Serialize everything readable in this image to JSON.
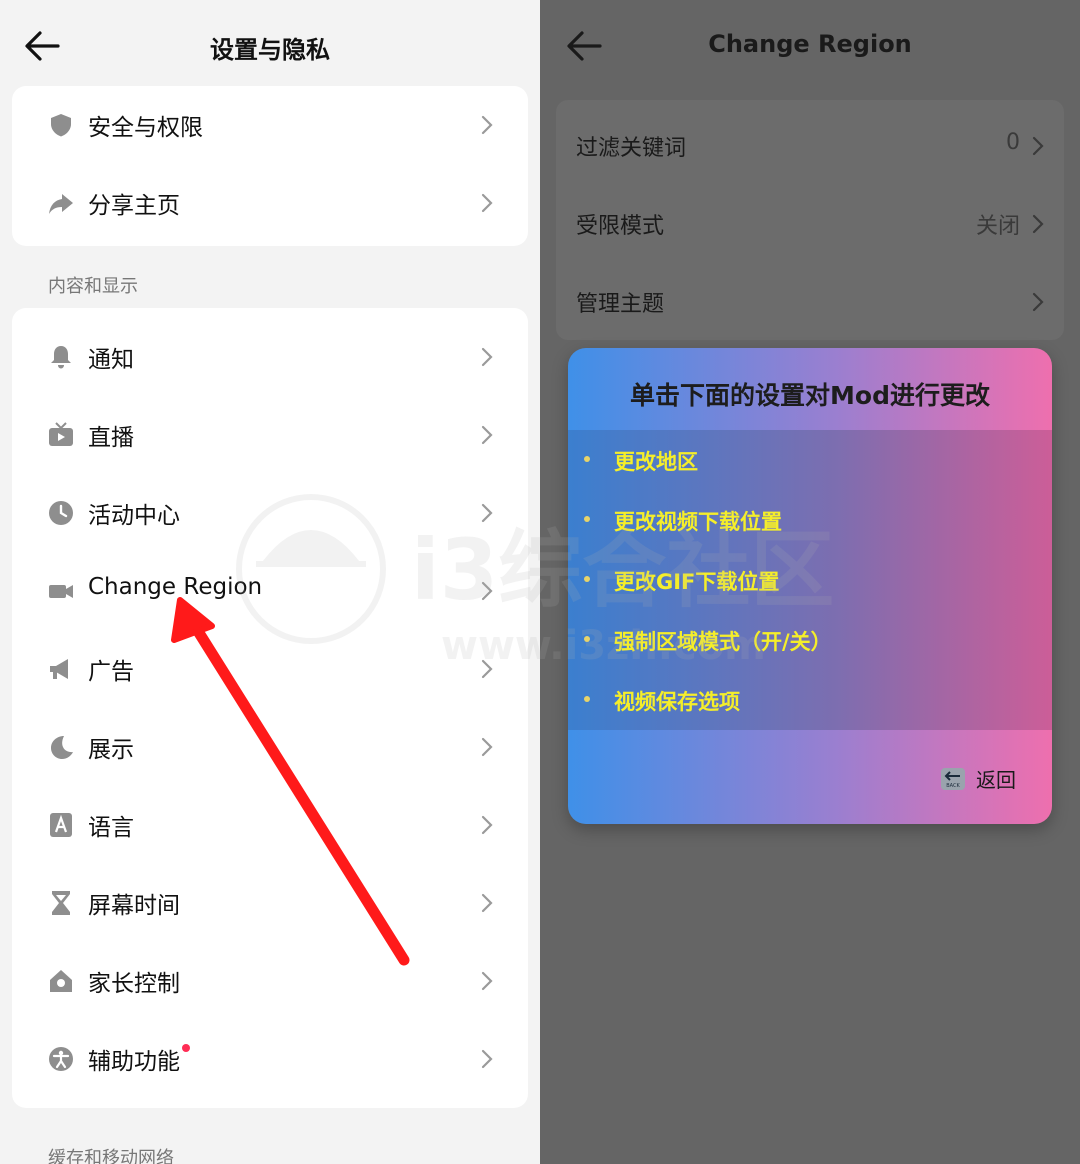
{
  "left": {
    "title": "设置与隐私",
    "group1": [
      {
        "label": "安全与权限",
        "icon": "shield-icon"
      },
      {
        "label": "分享主页",
        "icon": "share-icon"
      }
    ],
    "section_content": "内容和显示",
    "group2": [
      {
        "label": "通知",
        "icon": "bell-icon"
      },
      {
        "label": "直播",
        "icon": "tv-icon"
      },
      {
        "label": "活动中心",
        "icon": "clock-icon"
      },
      {
        "label": "Change Region",
        "icon": "video-camera-icon"
      },
      {
        "label": "广告",
        "icon": "megaphone-icon"
      },
      {
        "label": "展示",
        "icon": "moon-icon"
      },
      {
        "label": "语言",
        "icon": "language-icon"
      },
      {
        "label": "屏幕时间",
        "icon": "hourglass-icon"
      },
      {
        "label": "家长控制",
        "icon": "home-icon"
      },
      {
        "label": "辅助功能",
        "icon": "accessibility-icon"
      }
    ],
    "section_cache": "缓存和移动网络"
  },
  "right": {
    "title": "Change Region",
    "items": [
      {
        "label": "过滤关键词",
        "value": "0"
      },
      {
        "label": "受限模式",
        "value": "关闭"
      },
      {
        "label": "管理主题",
        "value": ""
      }
    ],
    "modal": {
      "title": "单击下面的设置对Mod进行更改",
      "options": [
        "更改地区",
        "更改视频下载位置",
        "更改GIF下载位置",
        "强制区域模式（开/关）",
        "视频保存选项"
      ],
      "back_label": "返回",
      "back_icon_text": "BACK"
    }
  },
  "watermark": {
    "text": "i3综合社区",
    "url": "www.i3zh.com"
  },
  "colors": {
    "accent_arrow": "#ff1a1a",
    "option_text": "#f5ee2a",
    "dim_overlay": "#656565",
    "badge_dot": "#ff2d55"
  }
}
